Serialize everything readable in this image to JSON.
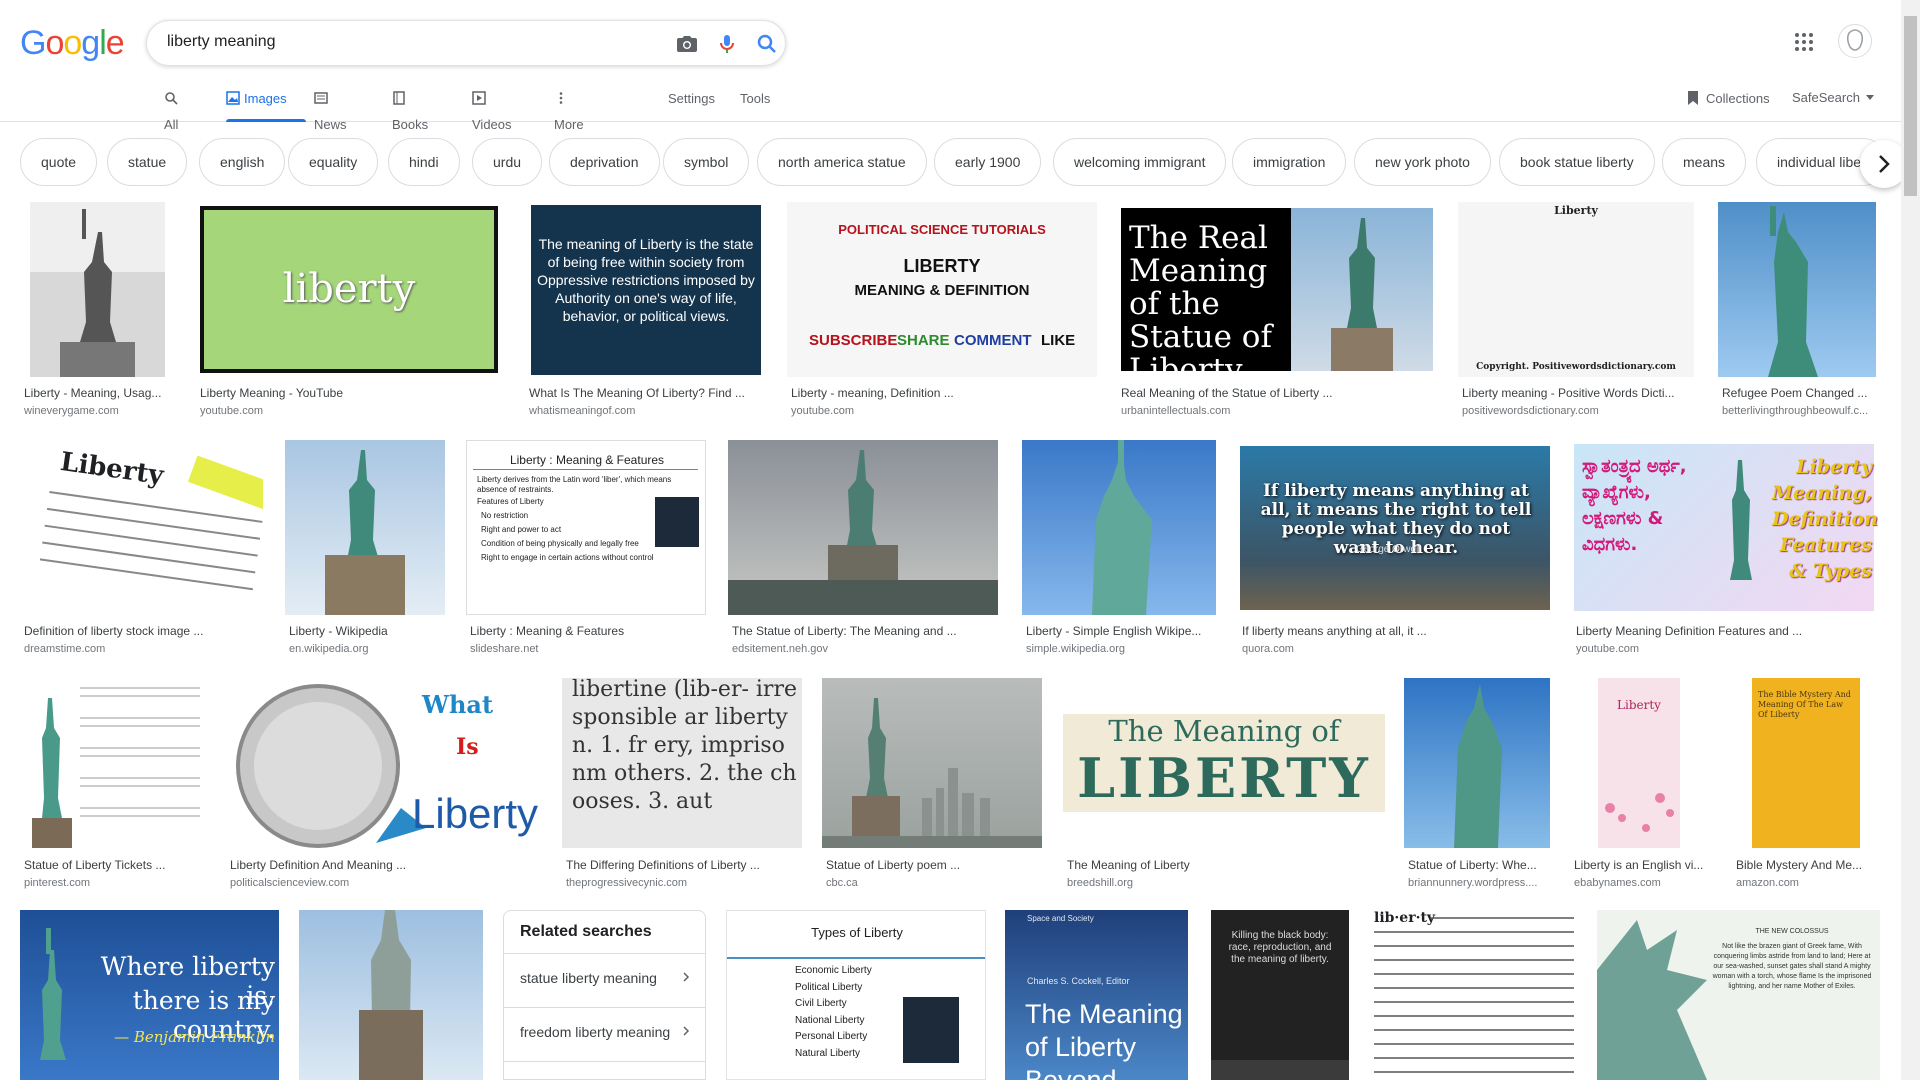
{
  "logo": "Google",
  "search": {
    "value": "liberty meaning"
  },
  "icons": {
    "camera": "camera-icon",
    "mic": "mic-icon",
    "search": "search-icon",
    "apps": "apps-grid-icon"
  },
  "nav": {
    "items": [
      {
        "label": "All",
        "icon": "search-icon"
      },
      {
        "label": "Images",
        "icon": "image-icon"
      },
      {
        "label": "News",
        "icon": "news-icon"
      },
      {
        "label": "Books",
        "icon": "book-icon"
      },
      {
        "label": "Videos",
        "icon": "video-icon"
      },
      {
        "label": "More",
        "icon": "more-icon"
      }
    ],
    "settings": "Settings",
    "tools": "Tools",
    "collections": "Collections",
    "safesearch": "SafeSearch"
  },
  "chips": [
    "quote",
    "statue",
    "english",
    "equality",
    "hindi",
    "urdu",
    "deprivation",
    "symbol",
    "north america statue",
    "early 1900",
    "welcoming immigrant",
    "immigration",
    "new york photo",
    "book statue liberty",
    "means",
    "individual liber"
  ],
  "results_row1": [
    {
      "title": "Liberty - Meaning, Usag...",
      "src": "wineverygame.com"
    },
    {
      "title": "Liberty Meaning - YouTube",
      "src": "youtube.com",
      "img_text": "liberty"
    },
    {
      "title": "What Is The Meaning Of Liberty? Find ...",
      "src": "whatismeaningof.com",
      "img_text": "The meaning of Liberty is the state of being free within society from Oppressive restrictions imposed by Authority on one's way of life, behavior, or political views."
    },
    {
      "title": "Liberty - meaning, Definition ...",
      "src": "youtube.com",
      "img_text1": "POLITICAL SCIENCE TUTORIALS",
      "img_text2": "LIBERTY",
      "img_text3": "MEANING & DEFINITION",
      "img_text4": "SUBSCRIBE",
      "img_text5": "SHARE",
      "img_text6": "COMMENT",
      "img_text7": "LIKE"
    },
    {
      "title": "Real Meaning of the Statue of Liberty ...",
      "src": "urbanintellectuals.com",
      "img_text": "The Real Meaning of the Statue of Liberty"
    },
    {
      "title": "Liberty meaning - Positive Words Dicti...",
      "src": "positivewordsdictionary.com",
      "img_text1": "Liberty",
      "img_text2": "Copyright. Positivewordsdictionary.com"
    },
    {
      "title": "Refugee Poem Changed ...",
      "src": "betterlivingthroughbeowulf.c..."
    }
  ],
  "results_row2": [
    {
      "title": "Definition of liberty stock image ...",
      "src": "dreamstime.com",
      "img_text": "Liberty"
    },
    {
      "title": "Liberty - Wikipedia",
      "src": "en.wikipedia.org"
    },
    {
      "title": "Liberty : Meaning & Features",
      "src": "slideshare.net",
      "img_text1": "Liberty : Meaning & Features",
      "img_text2": "Liberty derives from the Latin word 'liber', which means absence of restraints.",
      "img_text3": "Features of Liberty",
      "img_text4": "No restriction",
      "img_text5": "Right and power to act",
      "img_text6": "Condition of being physically and legally free",
      "img_text7": "Right to engage in certain actions without control"
    },
    {
      "title": "The Statue of Liberty: The Meaning and ...",
      "src": "edsitement.neh.gov"
    },
    {
      "title": "Liberty - Simple English Wikipe...",
      "src": "simple.wikipedia.org"
    },
    {
      "title": "If liberty means anything at all, it ...",
      "src": "quora.com",
      "img_text": "If liberty means anything at all, it means the right to tell people what they do not want to hear.",
      "img_author": "George Orwell"
    },
    {
      "title": "Liberty Meaning Definition Features and ...",
      "src": "youtube.com",
      "img_text1": "ಸ್ವಾತಂತ್ರ್ಯದ ಅರ್ಥ, ವ್ಯಾಖ್ಯೆಗಳು, ಲಕ್ಷಣಗಳು & ವಿಧಗಳು.",
      "img_text2": "Liberty Meaning, Definition, Features & Types"
    }
  ],
  "results_row3": [
    {
      "title": "Statue of Liberty Tickets ...",
      "src": "pinterest.com"
    },
    {
      "title": "Liberty Definition And Meaning ...",
      "src": "politicalscienceview.com",
      "img_text1": "What",
      "img_text2": "Is",
      "img_text3": "Liberty"
    },
    {
      "title": "The Differing Definitions of Liberty ...",
      "src": "theprogressivecynic.com",
      "img_text": "libertine (lib-er- irresponsible ar liberty n. 1. fr ery, imprisonm others. 2. the chooses. 3. aut"
    },
    {
      "title": "Statue of Liberty poem ...",
      "src": "cbc.ca"
    },
    {
      "title": "The Meaning of Liberty",
      "src": "breedshill.org",
      "img_text1": "The Meaning of",
      "img_text2": "LIBERTY"
    },
    {
      "title": "Statue of Liberty: Whe...",
      "src": "briannunnery.wordpress...."
    },
    {
      "title": "Liberty is an English vi...",
      "src": "ebabynames.com",
      "img_text": "Liberty"
    },
    {
      "title": "Bible Mystery And Me...",
      "src": "amazon.com",
      "img_text": "The Bible Mystery And Meaning Of The Law Of Liberty"
    }
  ],
  "results_row4": [
    {
      "img_text1": "Where liberty is,",
      "img_text2": "there is my country.",
      "img_text3": "— Benjamin Franklin"
    },
    {},
    {
      "img_text1": "Types of Liberty",
      "img_items": [
        "Economic Liberty",
        "Political Liberty",
        "Civil Liberty",
        "National Liberty",
        "Personal Liberty",
        "Natural Liberty"
      ]
    },
    {
      "img_text1": "Space and Society",
      "img_text2": "Charles S. Cockell, Editor",
      "img_text3": "The Meaning of Liberty Beyond"
    },
    {
      "img_text": "Killing the black body: race, reproduction, and the meaning of liberty."
    },
    {
      "img_text": "lib·er·ty"
    },
    {
      "img_text1": "THE NEW COLOSSUS",
      "img_text2": "Not like the brazen giant of Greek fame, With conquering limbs astride from land to land; Here at our sea-washed, sunset gates shall stand A mighty woman with a torch, whose flame Is the imprisoned lightning, and her name Mother of Exiles."
    }
  ],
  "related": {
    "heading": "Related searches",
    "items": [
      "statue liberty meaning",
      "freedom liberty meaning"
    ]
  }
}
